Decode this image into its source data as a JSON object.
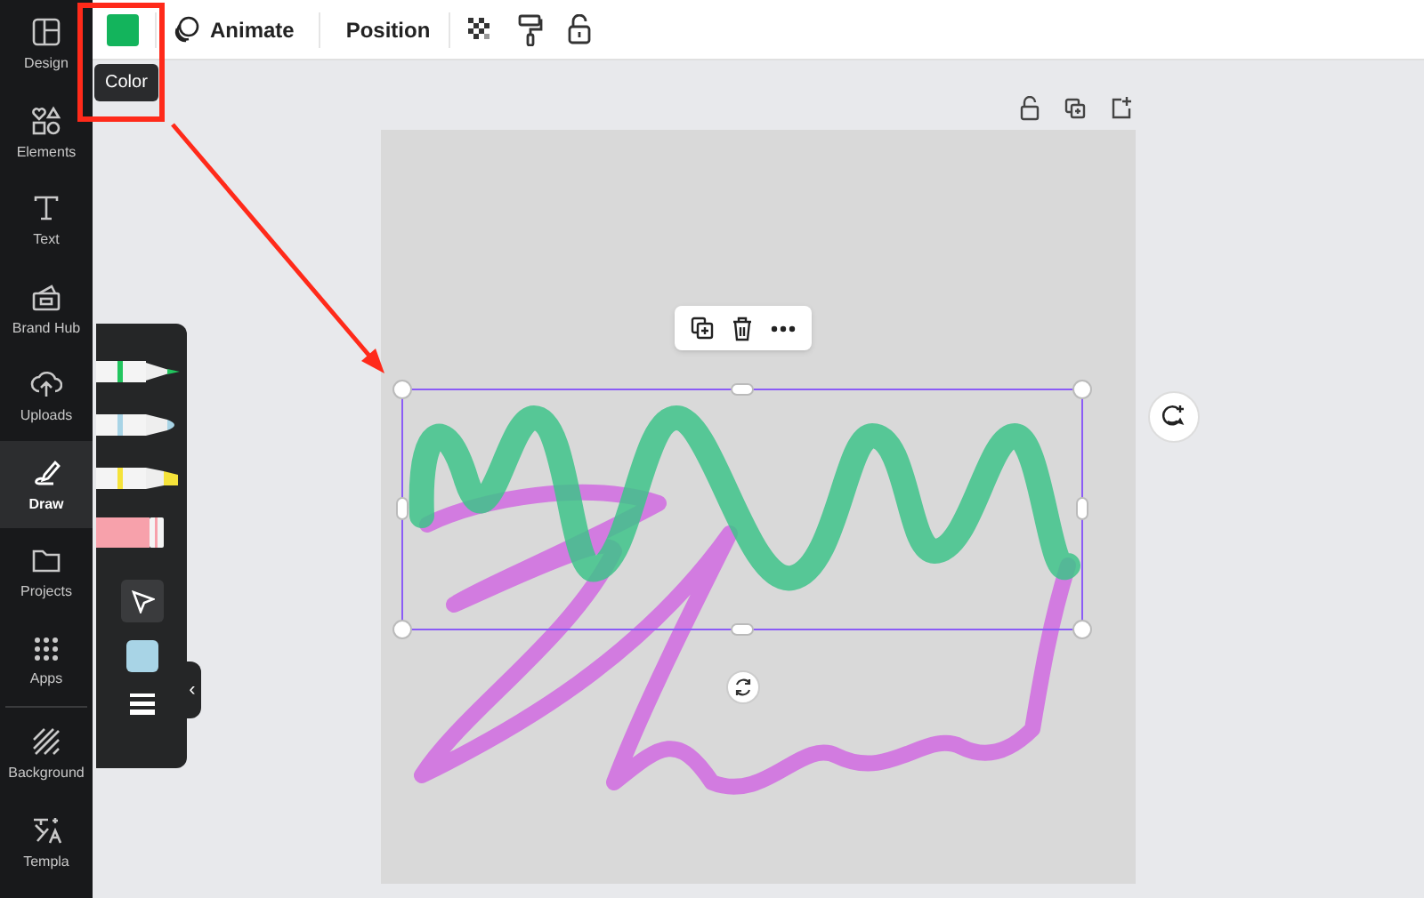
{
  "sidebar": {
    "items": [
      {
        "kind": "design",
        "label": "Design",
        "selected": false
      },
      {
        "kind": "elements",
        "label": "Elements",
        "selected": false
      },
      {
        "kind": "text",
        "label": "Text",
        "selected": false
      },
      {
        "kind": "brand",
        "label": "Brand Hub",
        "selected": false
      },
      {
        "kind": "uploads",
        "label": "Uploads",
        "selected": false
      },
      {
        "kind": "draw",
        "label": "Draw",
        "selected": true
      },
      {
        "kind": "projects",
        "label": "Projects",
        "selected": false
      },
      {
        "kind": "apps",
        "label": "Apps",
        "selected": false
      },
      {
        "kind": "background",
        "label": "Background",
        "selected": false
      },
      {
        "kind": "templates",
        "label": "Templa",
        "selected": false
      }
    ]
  },
  "toolbar": {
    "swatch": {
      "color": "#13b45c"
    },
    "tooltip": "Color",
    "animate": "Animate",
    "position": "Position"
  },
  "draw_panel": {
    "tools": [
      {
        "kind": "pen",
        "color": "#22c55e"
      },
      {
        "kind": "marker",
        "color": "#a8d4e6"
      },
      {
        "kind": "highlighter",
        "color": "#f5e33a"
      },
      {
        "kind": "eraser",
        "color": "#f7a1ab"
      }
    ],
    "current": {
      "color": "#a8d4e6"
    },
    "collapse": "‹"
  }
}
